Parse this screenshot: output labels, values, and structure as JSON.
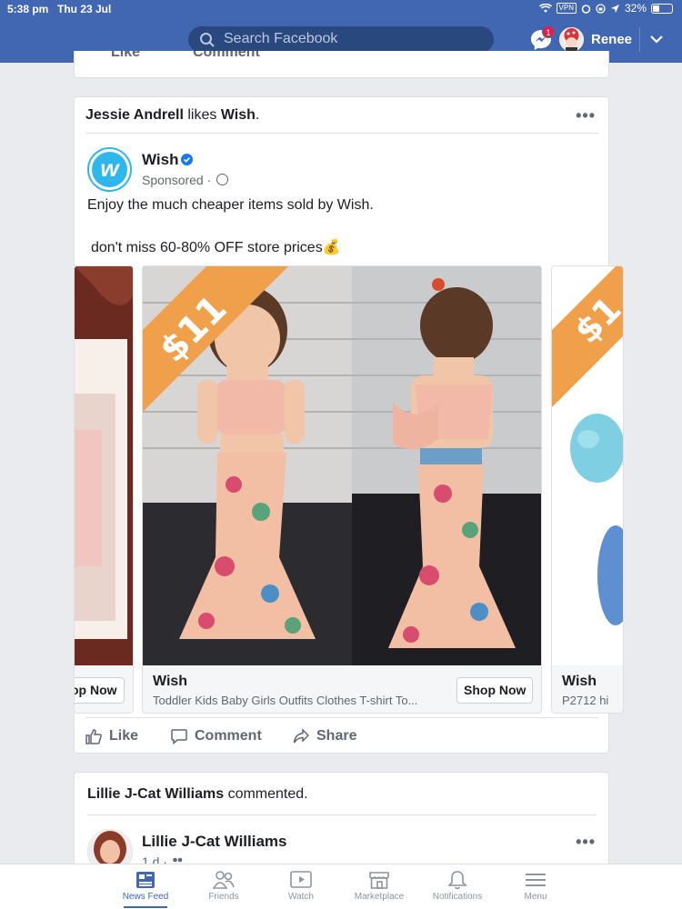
{
  "status_bar": {
    "time": "5:38 pm",
    "date": "Thu 23 Jul",
    "vpn": "VPN",
    "battery": "32%"
  },
  "header": {
    "search_placeholder": "Search Facebook",
    "messenger_badge": "1",
    "user_name": "Renee"
  },
  "prev_post": {
    "like": "Like",
    "comment": "Comment"
  },
  "post": {
    "story_actor": "Jessie Andrell",
    "story_verb": " likes ",
    "story_object": "Wish",
    "story_end": ".",
    "page_name": "Wish",
    "sponsored": "Sponsored ·",
    "text_line1": "Enjoy the much cheaper items sold by Wish.",
    "text_line2": "don't miss 60-80% OFF store prices💰",
    "carousel": [
      {
        "shop": "op Now"
      },
      {
        "price_tag": "$11",
        "title": "Wish",
        "desc": "Toddler Kids Baby Girls Outfits Clothes T-shirt To...",
        "shop": "Shop Now"
      },
      {
        "price_tag": "$1",
        "title": "Wish",
        "desc": "P2712 hi"
      }
    ],
    "actions": {
      "like": "Like",
      "comment": "Comment",
      "share": "Share"
    }
  },
  "next_post": {
    "story_actor": "Lillie J-Cat Williams",
    "story_verb": " commented.",
    "author": "Lillie J-Cat Williams",
    "time": "1 d ·"
  },
  "bottom_nav": [
    {
      "label": "News Feed",
      "icon": "news-feed-icon",
      "active": true
    },
    {
      "label": "Friends",
      "icon": "friends-icon"
    },
    {
      "label": "Watch",
      "icon": "watch-icon"
    },
    {
      "label": "Marketplace",
      "icon": "marketplace-icon"
    },
    {
      "label": "Notifications",
      "icon": "notifications-icon"
    },
    {
      "label": "Menu",
      "icon": "menu-icon"
    }
  ],
  "colors": {
    "brand": "#4267b2",
    "wish": "#2fb7ec",
    "price_tag": "#f0a04b"
  }
}
